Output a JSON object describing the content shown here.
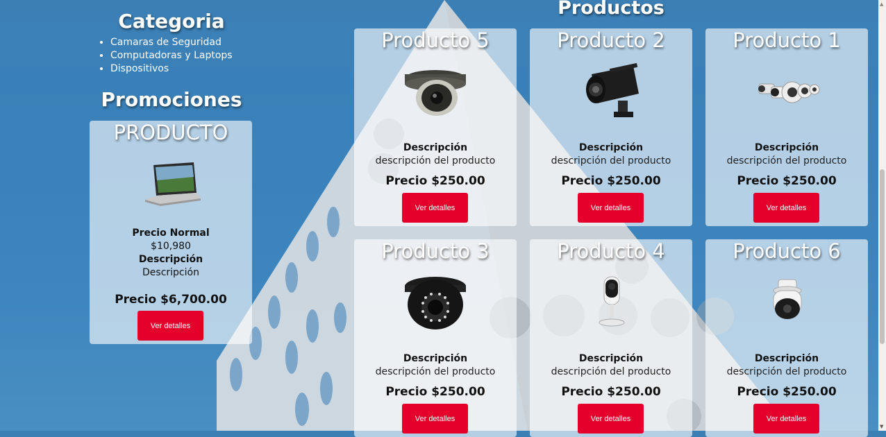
{
  "sidebar": {
    "category_title": "Categoria",
    "categories": [
      "Camaras de Seguridad",
      "Computadoras y Laptops",
      "Dispositivos"
    ],
    "promotions_title": "Promociones",
    "promo": {
      "title": "PRODUCTO",
      "image_icon": "laptop-icon",
      "normal_price_label": "Precio Normal",
      "normal_price": "$10,980",
      "description_label": "Descripción",
      "description": "Descripción",
      "price": "Precio $6,700.00",
      "button": "Ver detalles"
    }
  },
  "products_title": "Productos",
  "products": [
    {
      "title": "Producto 5",
      "image_icon": "dome-camera-icon",
      "description_label": "Descripción",
      "description": "descripción del producto",
      "price": "Precio $250.00",
      "button": "Ver detalles"
    },
    {
      "title": "Producto 2",
      "image_icon": "bullet-camera-icon",
      "description_label": "Descripción",
      "description": "descripción del producto",
      "price": "Precio $250.00",
      "button": "Ver detalles"
    },
    {
      "title": "Producto 1",
      "image_icon": "camera-kit-icon",
      "description_label": "Descripción",
      "description": "descripción del producto",
      "price": "Precio $250.00",
      "button": "Ver detalles"
    },
    {
      "title": "Producto 3",
      "image_icon": "black-dome-camera-icon",
      "description_label": "Descripción",
      "description": "descripción del producto",
      "price": "Precio $250.00",
      "button": "Ver detalles"
    },
    {
      "title": "Producto 4",
      "image_icon": "indoor-camera-icon",
      "description_label": "Descripción",
      "description": "descripción del producto",
      "price": "Precio $250.00",
      "button": "Ver detalles"
    },
    {
      "title": "Producto 6",
      "image_icon": "ptz-camera-icon",
      "description_label": "Descripción",
      "description": "descripción del producto",
      "price": "Precio $250.00",
      "button": "Ver detalles"
    }
  ],
  "colors": {
    "button": "#e4002b",
    "background": "#3b7fb5"
  }
}
